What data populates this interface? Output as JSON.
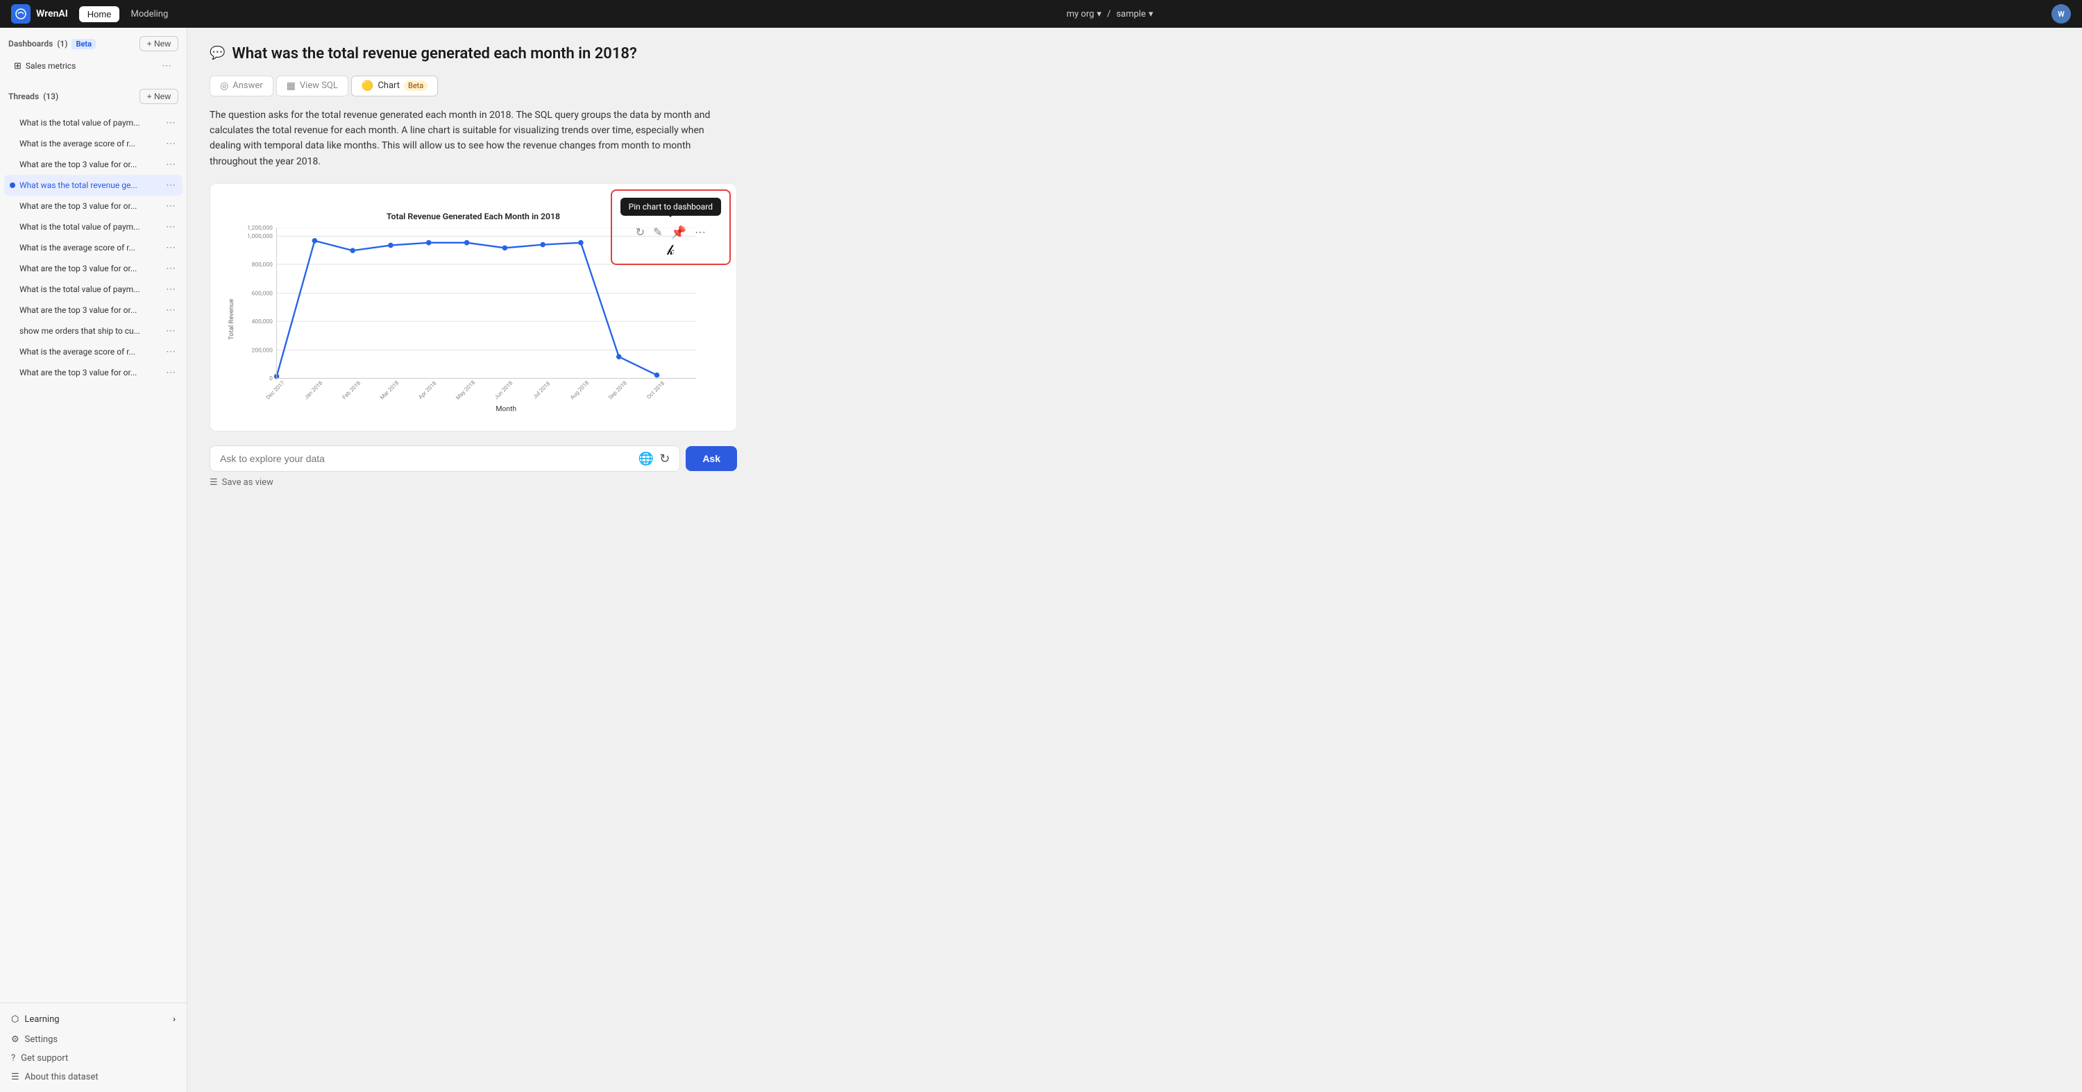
{
  "app": {
    "logo_text": "WrenAI",
    "logo_initial": "W",
    "nav_home": "Home",
    "nav_modeling": "Modeling"
  },
  "topnav": {
    "org": "my org",
    "sample": "sample",
    "avatar_initials": "W"
  },
  "sidebar": {
    "dashboards_label": "Dashboards",
    "dashboards_count": "(1)",
    "dashboards_beta": "Beta",
    "new_dashboard_label": "+ New",
    "sales_metrics": "Sales metrics",
    "threads_label": "Threads",
    "threads_count": "(13)",
    "new_thread_label": "+ New",
    "threads": [
      {
        "text": "What is the total value of paym...",
        "active": false
      },
      {
        "text": "What is the average score of r...",
        "active": false
      },
      {
        "text": "What are the top 3 value for or...",
        "active": false
      },
      {
        "text": "What was the total revenue ge...",
        "active": true
      },
      {
        "text": "What are the top 3 value for or...",
        "active": false
      },
      {
        "text": "What is the total value of paym...",
        "active": false
      },
      {
        "text": "What is the average score of r...",
        "active": false
      },
      {
        "text": "What are the top 3 value for or...",
        "active": false
      },
      {
        "text": "What is the total value of paym...",
        "active": false
      },
      {
        "text": "What are the top 3 value for or...",
        "active": false
      },
      {
        "text": "show me orders that ship to cu...",
        "active": false
      },
      {
        "text": "What is the average score of r...",
        "active": false
      },
      {
        "text": "What are the top 3 value for or...",
        "active": false
      }
    ],
    "learning_label": "Learning",
    "settings_label": "Settings",
    "support_label": "Get support",
    "dataset_label": "About this dataset"
  },
  "main": {
    "question": "What was the total revenue generated each month in 2018?",
    "tab_answer": "Answer",
    "tab_sql": "View SQL",
    "tab_chart": "Chart",
    "tab_chart_badge": "Beta",
    "answer_text": "The question asks for the total revenue generated each month in 2018. The SQL query groups the data by month and calculates the total revenue for each month. A line chart is suitable for visualizing trends over time, especially when dealing with temporal data like months. This will allow us to see how the revenue changes from month to month throughout the year 2018.",
    "chart_title": "Total Revenue Generated Each Month in 2018",
    "x_label": "Month",
    "y_label": "Total Revenue",
    "tooltip_label": "Pin chart to dashboard",
    "y_ticks": [
      "1,200,000",
      "1,000,000",
      "800,000",
      "600,000",
      "400,000",
      "200,000",
      "0"
    ],
    "x_ticks": [
      "Dec 2017",
      "Jan 2018",
      "Feb 2018",
      "Mar 2018",
      "Apr 2018",
      "May 2018",
      "Jun 2018",
      "Jul 2018",
      "Aug 2018",
      "Sep 2018",
      "Oct 2018"
    ],
    "chart_data": [
      {
        "x": 0.04,
        "y": 0.02,
        "label": "Dec 2017"
      },
      {
        "x": 0.13,
        "y": 0.88,
        "label": "Jan 2018"
      },
      {
        "x": 0.22,
        "y": 0.82,
        "label": "Feb 2018"
      },
      {
        "x": 0.31,
        "y": 0.85,
        "label": "Mar 2018"
      },
      {
        "x": 0.4,
        "y": 0.85,
        "label": "Apr 2018"
      },
      {
        "x": 0.49,
        "y": 0.85,
        "label": "May 2018"
      },
      {
        "x": 0.58,
        "y": 0.82,
        "label": "Jun 2018"
      },
      {
        "x": 0.67,
        "y": 0.84,
        "label": "Jul 2018"
      },
      {
        "x": 0.76,
        "y": 0.82,
        "label": "Aug 2018"
      },
      {
        "x": 0.85,
        "y": 0.08,
        "label": "Sep 2018"
      },
      {
        "x": 0.94,
        "y": 0.02,
        "label": "Oct 2018"
      }
    ]
  },
  "bottom": {
    "input_placeholder": "Ask to explore your data",
    "ask_button": "Ask",
    "save_view_label": "Save as view"
  }
}
